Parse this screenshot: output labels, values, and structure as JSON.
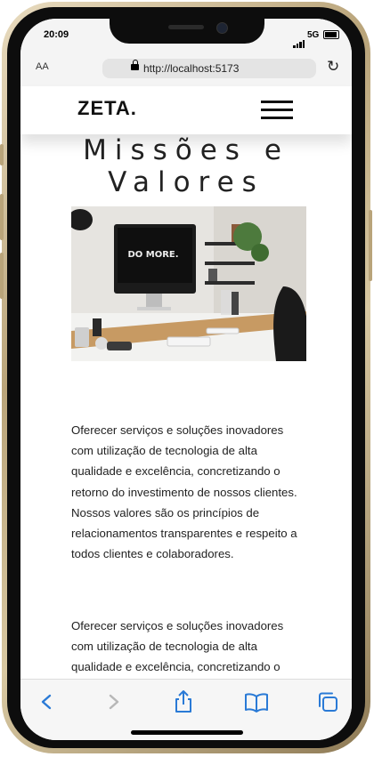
{
  "status_bar": {
    "time": "20:09",
    "network": "5G"
  },
  "browser": {
    "text_size_label": "AA",
    "url": "http://localhost:5173"
  },
  "site": {
    "logo": "ZETA.",
    "title": "Missões e Valores",
    "image_text": "DO MORE.",
    "paragraphs": [
      "Oferecer serviços e soluções inovadores com utilização de tecnologia de alta qualidade e excelência, concretizando o retorno do investimento de nossos clientes. Nossos valores são os princípios de relacionamentos transparentes e respeito a todos clientes e colaboradores.",
      "Oferecer serviços e soluções inovadores com utilização de tecnologia de alta qualidade e excelência, concretizando o retorno"
    ]
  },
  "toolbar": {
    "icons": [
      "back-arrow-icon",
      "forward-arrow-icon",
      "share-icon",
      "bookmarks-icon",
      "tabs-icon"
    ],
    "accent": "#2a7ad6",
    "disabled": "#b7b7b7"
  }
}
